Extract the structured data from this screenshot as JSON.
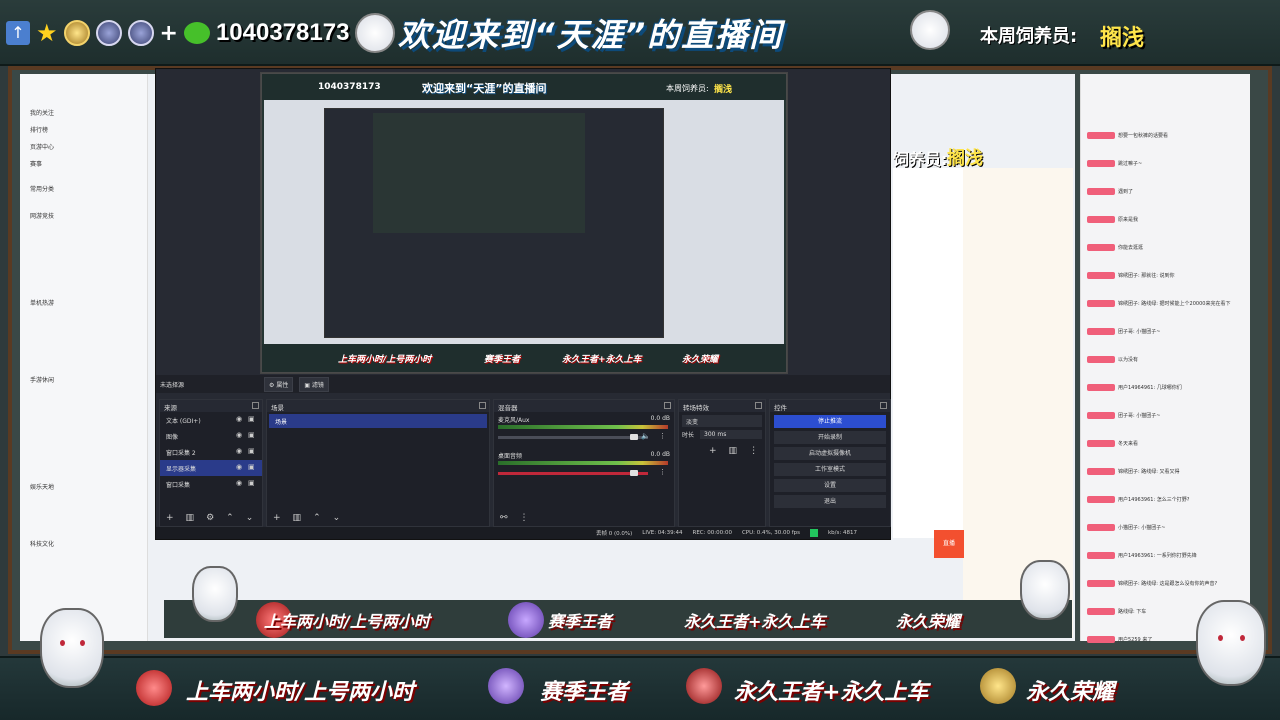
{
  "top_banner": {
    "qq_number": "1040378173",
    "welcome": "欢迎来到“天涯”的直播间",
    "feeder_label": "本周饲养员:",
    "feeder_name": "搁浅"
  },
  "nested": {
    "qq_number": "1040378173",
    "welcome": "欢迎来到“天涯”的直播间",
    "feeder_label": "本周饲养员:",
    "feeder_name": "搁浅"
  },
  "banner_items": [
    "上车两小时/上号两小时",
    "赛季王者",
    "永久王者+永久上车",
    "永久荣耀"
  ],
  "browser_side": {
    "items": [
      "我的关注",
      "排行榜",
      "页游中心",
      "赛事",
      "常用分类",
      "网游竞技",
      "单机热游",
      "手游休闲",
      "娱乐天地",
      "科技文化"
    ]
  },
  "mid_overlay": {
    "feeder_label": "饲养员:",
    "feeder_name": "搁浅"
  },
  "obs": {
    "no_source_selected": "未选择源",
    "properties_btn": "属性",
    "filters_btn": "滤镜",
    "panels": {
      "sources": "来源",
      "scenes": "场景",
      "mixer": "混音器",
      "transitions": "转场特效",
      "controls": "控件"
    },
    "sources": [
      "文本 (GDI+)",
      "图像",
      "窗口采集 2",
      "显示器采集",
      "窗口采集"
    ],
    "selected_source_index": 3,
    "scenes": [
      "场景"
    ],
    "mixer": [
      {
        "name": "麦克风/Aux",
        "db": "0.0 dB"
      },
      {
        "name": "桌面音频",
        "db": "0.0 dB"
      }
    ],
    "transitions": {
      "type": "淡变",
      "duration_label": "时长",
      "duration": "300 ms"
    },
    "controls": [
      "停止推流",
      "开始录制",
      "启动虚拟摄像机",
      "工作室模式",
      "设置",
      "退出"
    ],
    "status": {
      "dropped": "丢帧 0 (0.0%)",
      "live": "LIVE: 04:39:44",
      "rec": "REC: 00:00:00",
      "cpu": "CPU: 0.4%, 30.00 fps",
      "kbps": "kb/s: 4817"
    }
  },
  "right_chat": {
    "lines": [
      "想要一包秋裤的话要看",
      "跳过嘛子~",
      "遇到了",
      "原来是我",
      "你能去逛逛",
      "锦绣团子: 那就往: 说到你",
      "锦绣团子: 路线绿: 据时候能上个20000来完在看下",
      "团子哥: 小猫团子~",
      "以为没有",
      "用户14964961: 几球哪你们",
      "团子哥: 小猫团子~",
      "冬天来看",
      "锦绣团子: 路线绿: 又看又得",
      "用户14963961: 怎么三个打野?",
      "小猫团子: 小猫团子~",
      "用户14963961: 一系列你打野先锋",
      "锦绣团子: 路线绿: 这是跟怎么没有你的声音?",
      "路线绿: 下车",
      "用户5259 来了"
    ]
  },
  "colors": {
    "accent": "#2c4ed0",
    "obs_bg": "#272a33",
    "banner_text_shadow": "#7a0000",
    "feeder_name": "#ffe54a"
  }
}
